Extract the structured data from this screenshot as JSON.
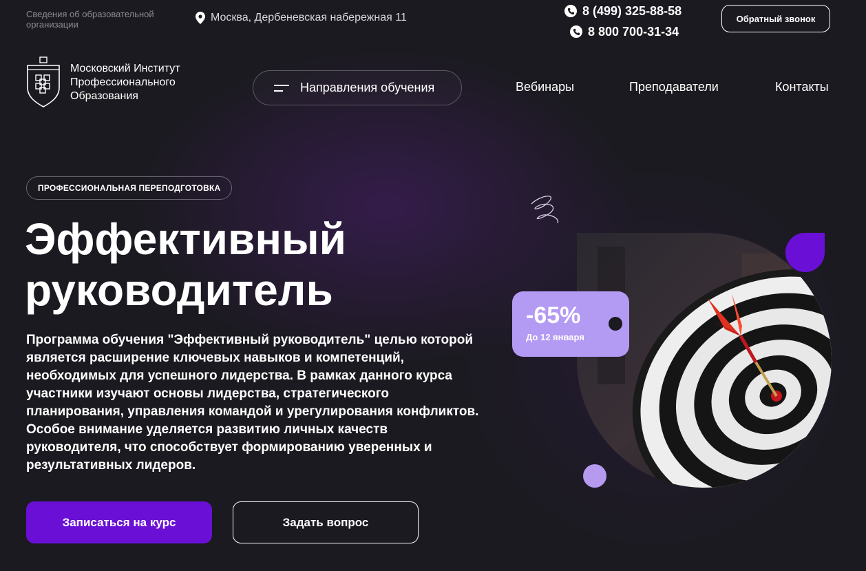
{
  "top_bar": {
    "org_info": "Сведения об образовательной организации",
    "address": "Москва, Дербеневская набережная 11",
    "phones": [
      "8 (499) 325-88-58",
      "8 800 700-31-34"
    ],
    "callback_label": "Обратный звонок"
  },
  "nav": {
    "logo_text": "Московский Институт Профессионального Образования",
    "directions_label": "Направления обучения",
    "links": [
      "Вебинары",
      "Преподаватели",
      "Контакты"
    ]
  },
  "hero": {
    "badge": "ПРОФЕССИОНАЛЬНАЯ ПЕРЕПОДГОТОВКА",
    "title": "Эффективный руководитель",
    "description": "Программа обучения \"Эффективный руководитель\" целью которой является расширение ключевых навыков и компетенций, необходимых для успешного лидерства. В рамках данного курса участники изучают основы лидерства, стратегического планирования, управления командой и урегулирования конфликтов. Особое внимание уделяется развитию личных качеств руководителя, что способствует формированию уверенных и результативных лидеров.",
    "enroll_label": "Записаться на курс",
    "question_label": "Задать вопрос"
  },
  "discount": {
    "value": "-65%",
    "until": "До 12 января"
  },
  "colors": {
    "background": "#1b1a20",
    "accent_purple": "#6a10d6",
    "lilac": "#b39af3"
  },
  "icons": {
    "address": "map-pin-icon",
    "phone": "phone-icon",
    "menu": "menu-lines-icon",
    "decoration": "squiggle-icon"
  }
}
